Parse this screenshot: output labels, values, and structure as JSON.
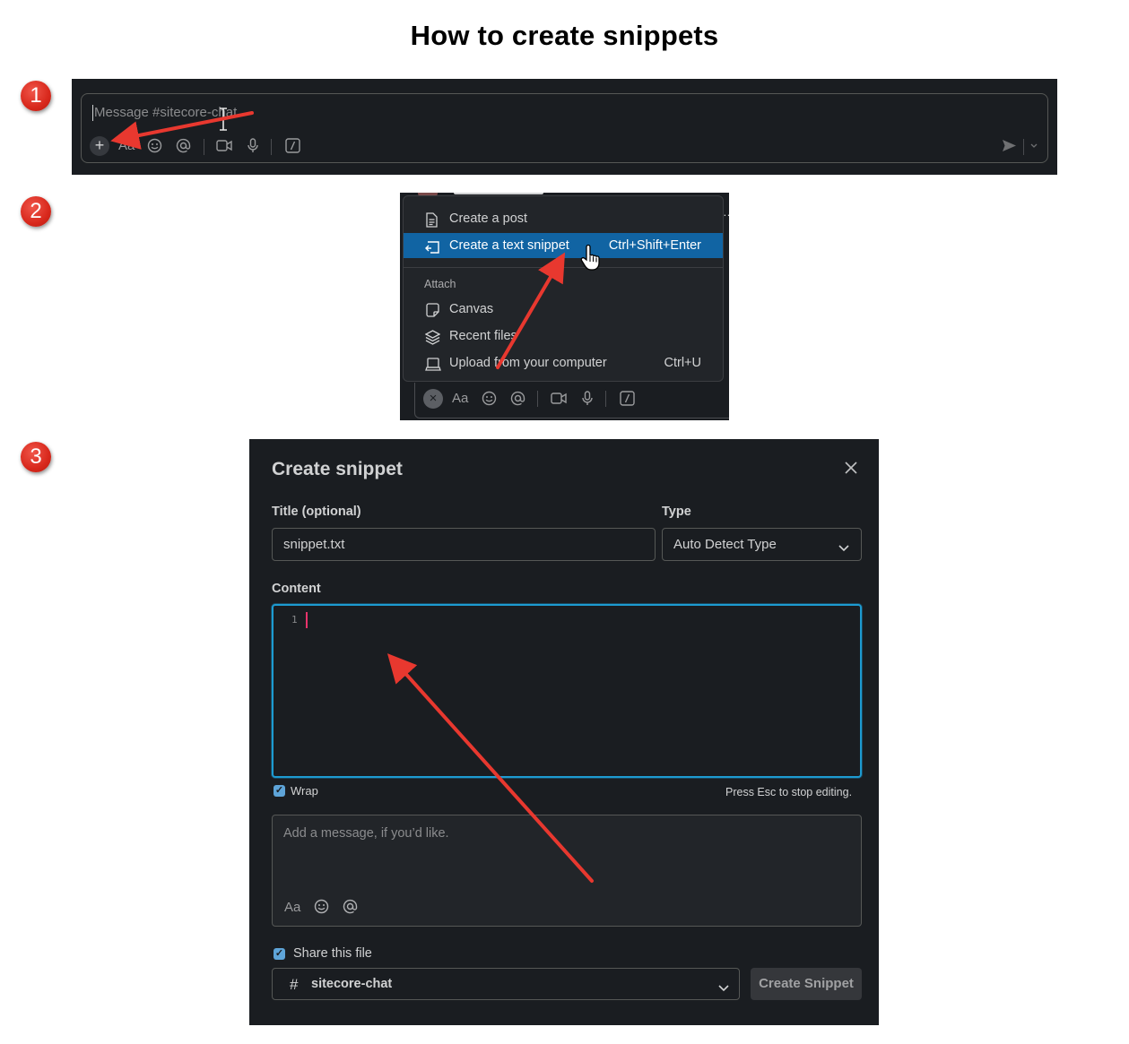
{
  "page": {
    "title": "How to create snippets"
  },
  "steps": [
    "1",
    "2",
    "3"
  ],
  "step1": {
    "placeholder": "Message #sitecore-chat",
    "toolbar": {
      "format_label": "Aa"
    }
  },
  "step2": {
    "header_fragment": "…",
    "menu": {
      "items": [
        {
          "label": "Create a post",
          "icon": "document-icon",
          "shortcut": ""
        },
        {
          "label": "Create a text snippet",
          "icon": "snippet-icon",
          "shortcut": "Ctrl+Shift+Enter",
          "active": true
        }
      ],
      "attach_header": "Attach",
      "attach_items": [
        {
          "label": "Canvas",
          "icon": "canvas-icon",
          "shortcut": ""
        },
        {
          "label": "Recent files",
          "icon": "layers-icon",
          "shortcut": ""
        },
        {
          "label": "Upload from your computer",
          "icon": "laptop-icon",
          "shortcut": "Ctrl+U"
        }
      ]
    },
    "toolbar": {
      "format_label": "Aa"
    }
  },
  "step3": {
    "modal_title": "Create snippet",
    "title_label": "Title (optional)",
    "title_value": "snippet.txt",
    "type_label": "Type",
    "type_value": "Auto Detect Type",
    "content_label": "Content",
    "line_number": "1",
    "wrap_label": "Wrap",
    "wrap_checked": true,
    "esc_hint": "Press Esc to stop editing.",
    "message_placeholder": "Add a message, if you’d like.",
    "format_label": "Aa",
    "share_label": "Share this file",
    "share_checked": true,
    "channel_hash": "#",
    "channel": "sitecore-chat",
    "create_button": "Create Snippet"
  },
  "colors": {
    "annotation_red": "#e8382f",
    "active_blue": "#1164a3",
    "focus_blue": "#1d9bd1"
  }
}
